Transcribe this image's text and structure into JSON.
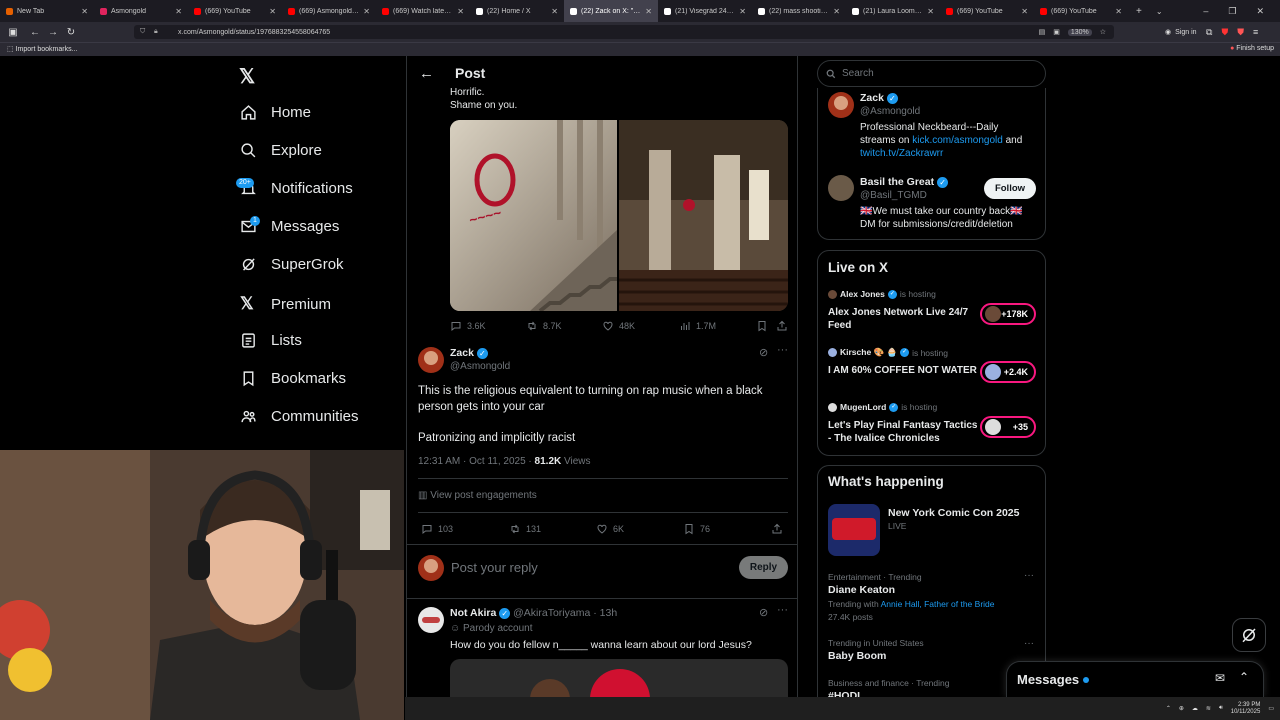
{
  "tabs": [
    {
      "label": "New Tab",
      "color": "#e66000"
    },
    {
      "label": "Asmongold",
      "color": "#e0245e"
    },
    {
      "label": "(669) YouTube",
      "color": "#ff0000"
    },
    {
      "label": "(669) Asmongold plays F",
      "color": "#ff0000"
    },
    {
      "label": "(669) Watch later - YouT",
      "color": "#ff0000"
    },
    {
      "label": "(22) Home / X",
      "color": "#ffffff"
    },
    {
      "label": "(22) Zack on X: \"@Basil",
      "color": "#ffffff",
      "active": true
    },
    {
      "label": "(21) Visegrád 24 (@vise",
      "color": "#ffffff"
    },
    {
      "label": "(22) mass shooting in Le",
      "color": "#ffffff"
    },
    {
      "label": "(21) Laura Loomer (@La",
      "color": "#ffffff"
    },
    {
      "label": "(669) YouTube",
      "color": "#ff0000"
    },
    {
      "label": "(669) YouTube",
      "color": "#ff0000"
    }
  ],
  "browser": {
    "url": "x.com/Asmongold/status/1976883254558064765",
    "zoom": "130%",
    "sign_in": "Sign in",
    "import_bookmarks": "Import bookmarks...",
    "finish_setup": "Finish setup"
  },
  "nav": {
    "home": "Home",
    "explore": "Explore",
    "notifications": "Notifications",
    "notif_badge": "20+",
    "messages": "Messages",
    "msg_badge": "1",
    "supergrok": "SuperGrok",
    "premium": "Premium",
    "lists": "Lists",
    "bookmarks": "Bookmarks",
    "communities": "Communities"
  },
  "header": {
    "title": "Post"
  },
  "quoted": {
    "line1": "Horrific.",
    "line2": "Shame on you.",
    "replies": "3.6K",
    "reposts": "8.7K",
    "likes": "48K",
    "views": "1.7M"
  },
  "post": {
    "author": "Zack",
    "handle": "@Asmongold",
    "text1": "This is the religious equivalent to turning on rap music when a black person gets into your car",
    "text2": "Patronizing and implicitly racist",
    "time": "12:31 AM · Oct 11, 2025 ·",
    "views_count": "81.2K",
    "views_label": "Views",
    "engagements": "View post engagements",
    "replies": "103",
    "reposts": "131",
    "likes": "6K",
    "bookmarks": "76"
  },
  "reply_box": {
    "placeholder": "Post your reply",
    "button": "Reply"
  },
  "reply": {
    "author": "Not Akira",
    "handle": "@AkiraToriyama",
    "time": "· 13h",
    "tag": "Parody account",
    "text": "How do you do fellow n_____ wanna learn about our lord Jesus?"
  },
  "search": {
    "placeholder": "Search"
  },
  "relevant": {
    "p1_name": "Zack",
    "p1_handle": "@Asmongold",
    "p1_bio_a": "Professional Neckbeard---Daily",
    "p1_bio_b": "streams on",
    "p1_link1": "kick.com/asmongold",
    "p1_and": "and",
    "p1_link2": "twitch.tv/Zackrawrr",
    "p2_name": "Basil the Great",
    "p2_handle": "@Basil_TGMD",
    "p2_follow": "Follow",
    "p2_bio_a": "🇬🇧We must take our country back🇬🇧",
    "p2_bio_b": "DM for submissions/credit/deletion"
  },
  "live": {
    "title": "Live on X",
    "items": [
      {
        "host": "Alex Jones",
        "status": "is hosting",
        "title": "Alex Jones Network Live 24/7 Feed",
        "count": "+178K"
      },
      {
        "host": "Kirsche 🎨 🧁",
        "status": "is hosting",
        "title": "I AM 60% COFFEE NOT WATER",
        "count": "+2.4K"
      },
      {
        "host": "MugenLord",
        "status": "is hosting",
        "title": "Let's Play Final Fantasy Tactics - The Ivalice Chronicles",
        "count": "+35"
      }
    ]
  },
  "happening": {
    "title": "What's happening",
    "event_title": "New York Comic Con 2025",
    "event_status": "LIVE",
    "t1_cat": "Entertainment · Trending",
    "t1_name": "Diane Keaton",
    "t1_with": "Trending with",
    "t1_links": "Annie Hall, Father of the Bride",
    "t1_posts": "27.4K posts",
    "t2_cat": "Trending in United States",
    "t2_name": "Baby Boom",
    "t3_cat": "Business and finance · Trending",
    "t3_name": "#HODL"
  },
  "messages_drawer": {
    "label": "Messages"
  },
  "taskbar": {
    "time": "2:39 PM",
    "date": "10/11/2025"
  }
}
